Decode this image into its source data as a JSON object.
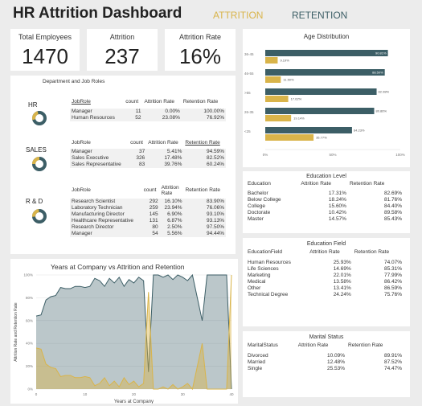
{
  "header": {
    "title": "HR Attrition Dashboard",
    "tabs": [
      {
        "label": "ATTRITION",
        "color": "#d9b44a"
      },
      {
        "label": "RETENTION",
        "color": "#3c5e66"
      }
    ]
  },
  "kpis": [
    {
      "label": "Total Employees",
      "value": "1470"
    },
    {
      "label": "Attrition",
      "value": "237"
    },
    {
      "label": "Attrition Rate",
      "value": "16%"
    }
  ],
  "departments": {
    "title": "Department and Job Roles",
    "columns": [
      "JobRole",
      "count",
      "Attrition Rate",
      "Retention Rate"
    ],
    "groups": [
      {
        "name": "HR",
        "rows": [
          [
            "Manager",
            "11",
            "0.00%",
            "100.00%"
          ],
          [
            "Human Resources",
            "52",
            "23.08%",
            "76.92%"
          ]
        ]
      },
      {
        "name": "SALES",
        "rows": [
          [
            "Manager",
            "37",
            "5.41%",
            "94.59%"
          ],
          [
            "Sales Executive",
            "326",
            "17.48%",
            "82.52%"
          ],
          [
            "Sales Representative",
            "83",
            "39.76%",
            "60.24%"
          ]
        ]
      },
      {
        "name": "R & D",
        "rows": [
          [
            "Research Scientist",
            "292",
            "16.10%",
            "83.90%"
          ],
          [
            "Laboratory Technician",
            "259",
            "23.94%",
            "76.06%"
          ],
          [
            "Manufacturing Director",
            "145",
            "6.90%",
            "93.10%"
          ],
          [
            "Healthcare Representative",
            "131",
            "6.87%",
            "93.13%"
          ],
          [
            "Research Director",
            "80",
            "2.50%",
            "97.50%"
          ],
          [
            "Manager",
            "54",
            "5.56%",
            "94.44%"
          ]
        ]
      }
    ]
  },
  "age": {
    "title": "Age Distribution",
    "chart_data": {
      "type": "bar",
      "categories": [
        "36-45",
        "46-55",
        ">55",
        "26-35",
        "<25"
      ],
      "series": [
        {
          "values": [
            90.81,
            88.5,
            82.46,
            80.66,
            64.23
          ],
          "color": "#3c5e66"
        },
        {
          "values": [
            9.19,
            11.5,
            17.02,
            19.14,
            35.77
          ],
          "color": "#d9b44a"
        }
      ],
      "labels_retention": [
        "90.81%",
        "88.50%",
        "82.98%",
        "80.86%",
        "64.23%"
      ],
      "labels_attrition": [
        "9.19%",
        "11.50%",
        "17.02%",
        "19.14%",
        "35.77%"
      ],
      "xticks": [
        "0%",
        "50%",
        "100%"
      ],
      "xlim": [
        0,
        100
      ]
    }
  },
  "education": {
    "title": "Education Level",
    "columns": [
      "Education",
      "Attrition Rate",
      "Retention Rate"
    ],
    "rows": [
      [
        "Bachelor",
        "17.31%",
        "82.69%"
      ],
      [
        "Below College",
        "18.24%",
        "81.76%"
      ],
      [
        "College",
        "15.60%",
        "84.40%"
      ],
      [
        "Doctorate",
        "10.42%",
        "89.58%"
      ],
      [
        "Master",
        "14.57%",
        "85.43%"
      ]
    ]
  },
  "field": {
    "title": "Education Field",
    "columns": [
      "EducationField",
      "Attrition Rate",
      "Retention Rate"
    ],
    "rows": [
      [
        "Human Resources",
        "25.93%",
        "74.07%"
      ],
      [
        "Life Sciences",
        "14.69%",
        "85.31%"
      ],
      [
        "Marketing",
        "22.01%",
        "77.99%"
      ],
      [
        "Medical",
        "13.58%",
        "86.42%"
      ],
      [
        "Other",
        "13.41%",
        "86.59%"
      ],
      [
        "Technical Degree",
        "24.24%",
        "75.76%"
      ]
    ]
  },
  "marital": {
    "title": "Marital Status",
    "columns": [
      "MaritalStatus",
      "Attrition Rate",
      "Retention Rate"
    ],
    "rows": [
      [
        "Divorced",
        "10.09%",
        "89.91%"
      ],
      [
        "Married",
        "12.48%",
        "87.52%"
      ],
      [
        "Single",
        "25.53%",
        "74.47%"
      ]
    ]
  },
  "years": {
    "title": "Years at Company vs Attrition and Retention",
    "chart_data": {
      "type": "area",
      "xlabel": "Years at Company",
      "ylabel": "Attrition Rate and Retention Rate",
      "xticks": [
        "0",
        "10",
        "20",
        "30",
        "40"
      ],
      "yticks": [
        "0%",
        "20%",
        "40%",
        "60%",
        "80%",
        "100%"
      ],
      "xlim": [
        0,
        40
      ],
      "ylim": [
        0,
        100
      ],
      "x": [
        0,
        1,
        2,
        3,
        4,
        5,
        6,
        7,
        8,
        9,
        10,
        11,
        12,
        13,
        14,
        15,
        16,
        17,
        18,
        19,
        20,
        21,
        22,
        23,
        24,
        25,
        26,
        27,
        28,
        29,
        30,
        31,
        32,
        33,
        34,
        35,
        36,
        37,
        38,
        39,
        40
      ],
      "series": [
        {
          "name": "Retention",
          "color": "#3c5e66",
          "values": [
            64,
            65,
            78,
            81,
            82,
            89,
            88,
            88,
            90,
            90,
            89,
            90,
            97,
            95,
            90,
            97,
            93,
            98,
            90,
            96,
            93,
            98,
            95,
            15,
            100,
            100,
            98,
            100,
            96,
            100,
            98,
            95,
            100,
            80,
            60,
            100,
            100,
            100,
            100,
            100,
            0
          ]
        },
        {
          "name": "Attrition",
          "color": "#d9b44a",
          "values": [
            36,
            35,
            22,
            19,
            18,
            11,
            12,
            12,
            10,
            10,
            11,
            10,
            3,
            5,
            10,
            3,
            7,
            2,
            10,
            4,
            7,
            2,
            5,
            85,
            0,
            0,
            2,
            0,
            4,
            0,
            2,
            5,
            0,
            20,
            40,
            0,
            0,
            0,
            0,
            0,
            100
          ]
        }
      ]
    }
  }
}
